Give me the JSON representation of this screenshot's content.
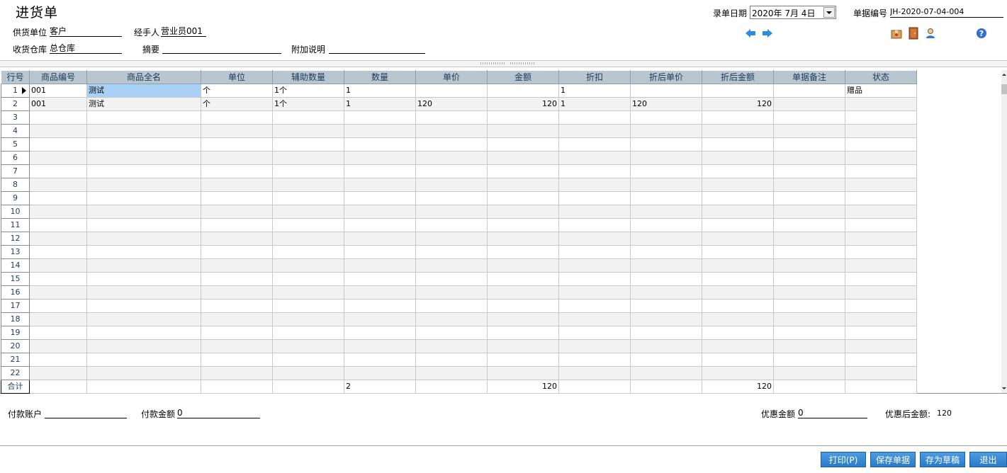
{
  "title": "进货单",
  "header": {
    "supplier_label": "供货单位",
    "supplier_value": "客户",
    "handler_label": "经手人",
    "handler_value": "营业员001",
    "warehouse_label": "收货仓库",
    "warehouse_value": "总仓库",
    "summary_label": "摘要",
    "summary_value": "",
    "note_label": "附加说明",
    "note_value": "",
    "date_label": "录单日期",
    "date_value": "2020年  7月  4日",
    "docno_label": "单据编号",
    "docno_value": "JH-2020-07-04-004"
  },
  "icons": {
    "prev": "arrow-left-icon",
    "next": "arrow-right-icon",
    "box": "box-icon",
    "door": "door-icon",
    "user": "user-icon",
    "help": "help-icon"
  },
  "colors": {
    "header_bg": "#b9c6cf",
    "header_text": "#1c3a5e",
    "selected_cell": "#a9d0f5",
    "button_bg": "#2a7bc8",
    "arrow_blue": "#2f8be0"
  },
  "grid": {
    "columns": [
      "行号",
      "商品编号",
      "商品全名",
      "单位",
      "辅助数量",
      "数量",
      "单价",
      "金额",
      "折扣",
      "折后单价",
      "折后金额",
      "单据备注",
      "状态"
    ],
    "rows": [
      {
        "no": "1",
        "code": "001",
        "name": "测试",
        "unit": "个",
        "aux": "1个",
        "qty": "1",
        "price": "",
        "amount": "",
        "discount": "1",
        "dprice": "",
        "damount": "",
        "remark": "",
        "status": "赠品"
      },
      {
        "no": "2",
        "code": "001",
        "name": "测试",
        "unit": "个",
        "aux": "1个",
        "qty": "1",
        "price": "120",
        "amount": "120",
        "discount": "1",
        "dprice": "120",
        "damount": "120",
        "remark": "",
        "status": ""
      },
      {
        "no": "3"
      },
      {
        "no": "4"
      },
      {
        "no": "5"
      },
      {
        "no": "6"
      },
      {
        "no": "7"
      },
      {
        "no": "8"
      },
      {
        "no": "9"
      },
      {
        "no": "10"
      },
      {
        "no": "11"
      },
      {
        "no": "12"
      },
      {
        "no": "13"
      },
      {
        "no": "14"
      },
      {
        "no": "15"
      },
      {
        "no": "16"
      },
      {
        "no": "17"
      },
      {
        "no": "18"
      },
      {
        "no": "19"
      },
      {
        "no": "20"
      },
      {
        "no": "21"
      },
      {
        "no": "22"
      }
    ],
    "total": {
      "label": "合计",
      "qty": "2",
      "amount": "120",
      "damount": "120"
    }
  },
  "footer": {
    "account_label": "付款账户",
    "account_value": "",
    "payment_label": "付款金额",
    "payment_value": "0",
    "discount_label": "优惠金额",
    "discount_value": "0",
    "after_discount_label": "优惠后金额:",
    "after_discount_value": "120"
  },
  "buttons": {
    "print": "打印(P)",
    "save": "保存单据",
    "draft": "存为草稿",
    "exit": "退出"
  }
}
